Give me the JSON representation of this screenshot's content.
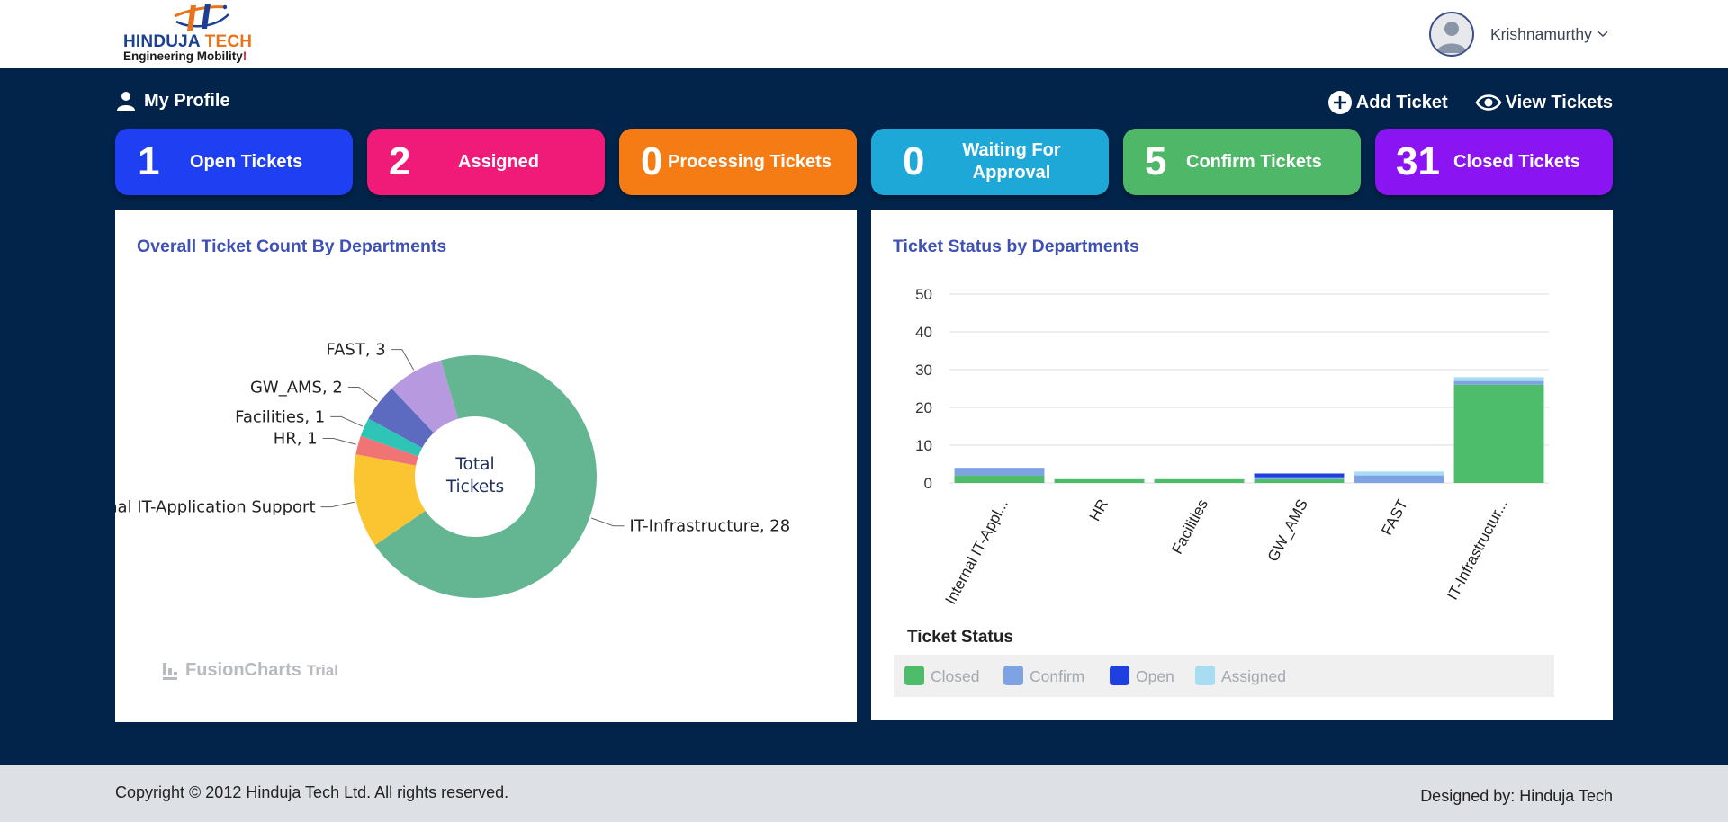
{
  "header": {
    "logo": {
      "brand_main": "HINDUJA",
      "brand_accent": "TECH",
      "tagline": "Engineering Mobility",
      "tagline_mark": "!"
    },
    "user_name": "Krishnamurthy"
  },
  "nav": {
    "my_profile": "My Profile",
    "add_ticket": "Add Ticket",
    "view_tickets": "View Tickets"
  },
  "status_cards": [
    {
      "count": "1",
      "label": "Open Tickets",
      "color": "#1f3ff2"
    },
    {
      "count": "2",
      "label": "Assigned",
      "color": "#f01a78"
    },
    {
      "count": "0",
      "label": "Processing Tickets",
      "color": "#f57c14"
    },
    {
      "count": "0",
      "label": "Waiting For Approval",
      "color": "#1da8d8"
    },
    {
      "count": "5",
      "label": "Confirm Tickets",
      "color": "#4fb868"
    },
    {
      "count": "31",
      "label": "Closed Tickets",
      "color": "#8a14f2"
    }
  ],
  "panels": {
    "left_title": "Overall Ticket Count By Departments",
    "right_title": "Ticket Status by Departments",
    "watermark": "FusionCharts",
    "watermark_suffix": "Trial"
  },
  "chart_data": [
    {
      "type": "pie",
      "title": "Overall Ticket Count By Departments",
      "center_label": [
        "Total",
        "Tickets"
      ],
      "slices": [
        {
          "label": "IT-Infrastructure, 28",
          "value": 28,
          "color": "#64b591"
        },
        {
          "label": "Internal IT-Application Support",
          "value": 5,
          "color": "#fbc531"
        },
        {
          "label": "HR, 1",
          "value": 1,
          "color": "#f17474"
        },
        {
          "label": "Facilities, 1",
          "value": 1,
          "color": "#2ec4b6"
        },
        {
          "label": "GW_AMS, 2",
          "value": 2,
          "color": "#5c6bc0"
        },
        {
          "label": "FAST, 3",
          "value": 3,
          "color": "#b799e0"
        }
      ]
    },
    {
      "type": "bar",
      "stacked": true,
      "title": "Ticket Status by Departments",
      "categories": [
        "Internal IT-Appl...",
        "HR",
        "Facilities",
        "GW_AMS",
        "FAST",
        "IT-Infrastructur..."
      ],
      "ylim": [
        0,
        50
      ],
      "yticks": [
        "0",
        "10",
        "20",
        "30",
        "40",
        "50"
      ],
      "grid": true,
      "legend_title": "Ticket Status",
      "legend_position": "bottom",
      "series": [
        {
          "name": "Closed",
          "color": "#4ebd6b",
          "values": [
            2,
            1,
            1,
            1,
            0,
            26
          ]
        },
        {
          "name": "Confirm",
          "color": "#7ea3e5",
          "values": [
            2,
            0,
            0,
            0.5,
            2,
            1
          ]
        },
        {
          "name": "Open",
          "color": "#1f3fe0",
          "values": [
            0,
            0,
            0,
            1,
            0,
            0
          ]
        },
        {
          "name": "Assigned",
          "color": "#a8dcf2",
          "values": [
            0,
            0,
            0,
            0,
            1,
            1
          ]
        }
      ]
    }
  ],
  "footer": {
    "copyright": "Copyright © 2012 Hinduja Tech Ltd. All rights reserved.",
    "designed_by": "Designed by: Hinduja Tech"
  }
}
